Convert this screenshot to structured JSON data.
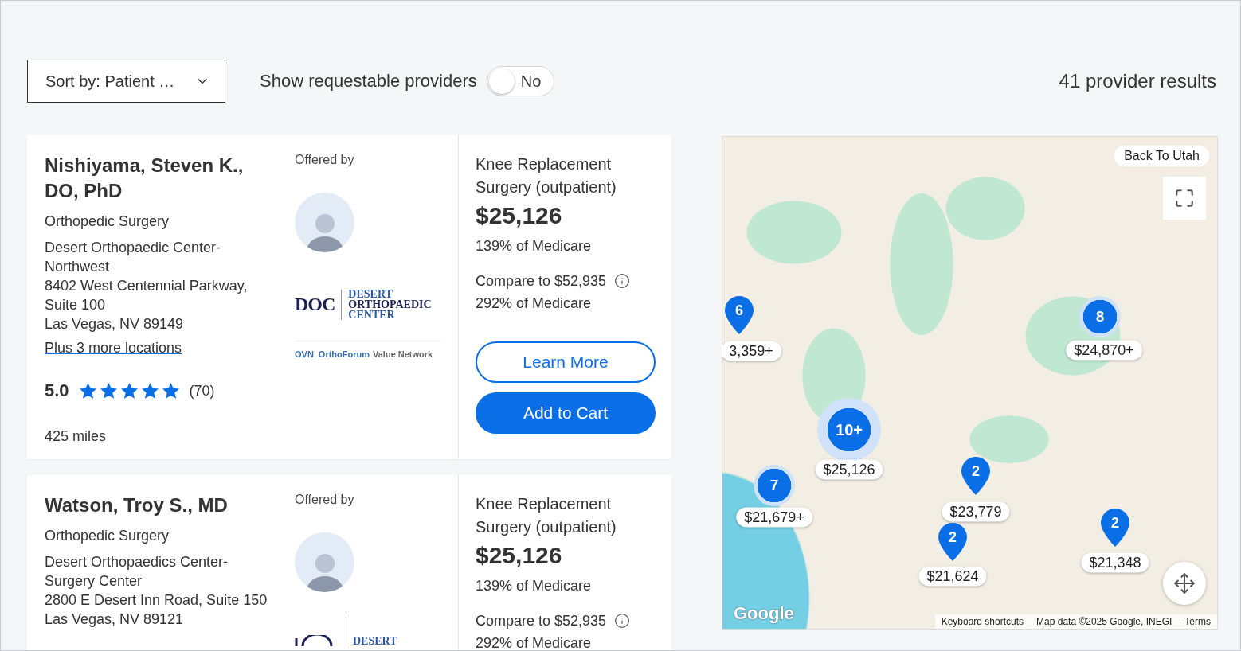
{
  "sort": {
    "label": "Sort by: Patient …"
  },
  "requestable": {
    "label": "Show requestable providers",
    "on": false,
    "state_label": "No"
  },
  "results_count": "41 provider results",
  "providers": [
    {
      "name": "Nishiyama, Steven K., DO, PhD",
      "specialty": "Orthopedic Surgery",
      "facility": "Desert Orthopaedic Center-Northwest",
      "street": "8402 West Centennial Parkway, Suite 100",
      "city": "Las Vegas, NV 89149",
      "more_locations": "Plus 3 more locations",
      "rating": "5.0",
      "stars": 5,
      "reviews": "(70)",
      "distance": "425 miles",
      "offered_by": "Offered by",
      "org_logo": {
        "mark": "DOC",
        "lines": [
          "DESERT",
          "ORTHOPAEDIC",
          "CENTER"
        ]
      },
      "network_logo": {
        "mark": "OVN",
        "brand": "OrthoForum",
        "rest": "Value Network"
      },
      "procedure": "Knee Replacement Surgery (outpatient)",
      "price": "$25,126",
      "price_pct": "139% of Medicare",
      "compare": "Compare to $52,935",
      "compare_pct": "292% of Medicare",
      "buttons": [
        {
          "label": "Learn More",
          "kind": "outline"
        },
        {
          "label": "Add to Cart",
          "kind": "primary"
        }
      ]
    },
    {
      "name": "Watson, Troy S., MD",
      "specialty": "Orthopedic Surgery",
      "facility": "Desert Orthopaedics Center-Surgery Center",
      "street": "2800 E Desert Inn Road, Suite 150",
      "city": "Las Vegas, NV 89121",
      "offered_by": "Offered by",
      "org_logo": {
        "lines": [
          "DESERT"
        ]
      },
      "procedure": "Knee Replacement Surgery (outpatient)",
      "price": "$25,126",
      "price_pct": "139% of Medicare",
      "compare": "Compare to $52,935",
      "compare_pct": "292% of Medicare"
    }
  ],
  "map": {
    "back_button": "Back To Utah",
    "markers": [
      {
        "kind": "pin",
        "count": "6",
        "price": "3,359+"
      },
      {
        "kind": "cluster",
        "count": "8",
        "price": "$24,870+"
      },
      {
        "kind": "cluster",
        "count": "10+",
        "price": "$25,126"
      },
      {
        "kind": "cluster",
        "count": "7",
        "price": "$21,679+"
      },
      {
        "kind": "pin",
        "count": "2",
        "price": "$23,779"
      },
      {
        "kind": "pin",
        "count": "2",
        "price": "$21,624"
      },
      {
        "kind": "pin",
        "count": "2",
        "price": "$21,348"
      }
    ],
    "logo": "Google",
    "attribution": [
      "Keyboard shortcuts",
      "Map data ©2025 Google, INEGI",
      "Terms"
    ]
  }
}
